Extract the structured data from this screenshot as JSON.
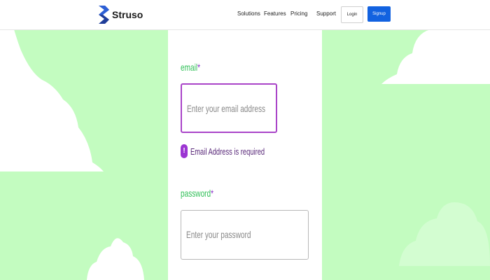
{
  "brand": {
    "name": "Struso"
  },
  "nav": {
    "items": [
      "Solutions",
      "Features",
      "Pricing",
      "Support"
    ],
    "login": "Login",
    "signup": "Signup"
  },
  "form": {
    "email_label": "email",
    "email_required": "*",
    "email_placeholder": "Enter your email address",
    "email_error": "Email Address is required",
    "error_icon": "!",
    "password_label": "password",
    "password_required": "*",
    "password_placeholder": "Enter your password"
  },
  "colors": {
    "background": "#c3fcc0",
    "label": "#33c05a",
    "required": "#8a2fc9",
    "error_border": "#a944c8",
    "primary_button": "#1262e0"
  }
}
